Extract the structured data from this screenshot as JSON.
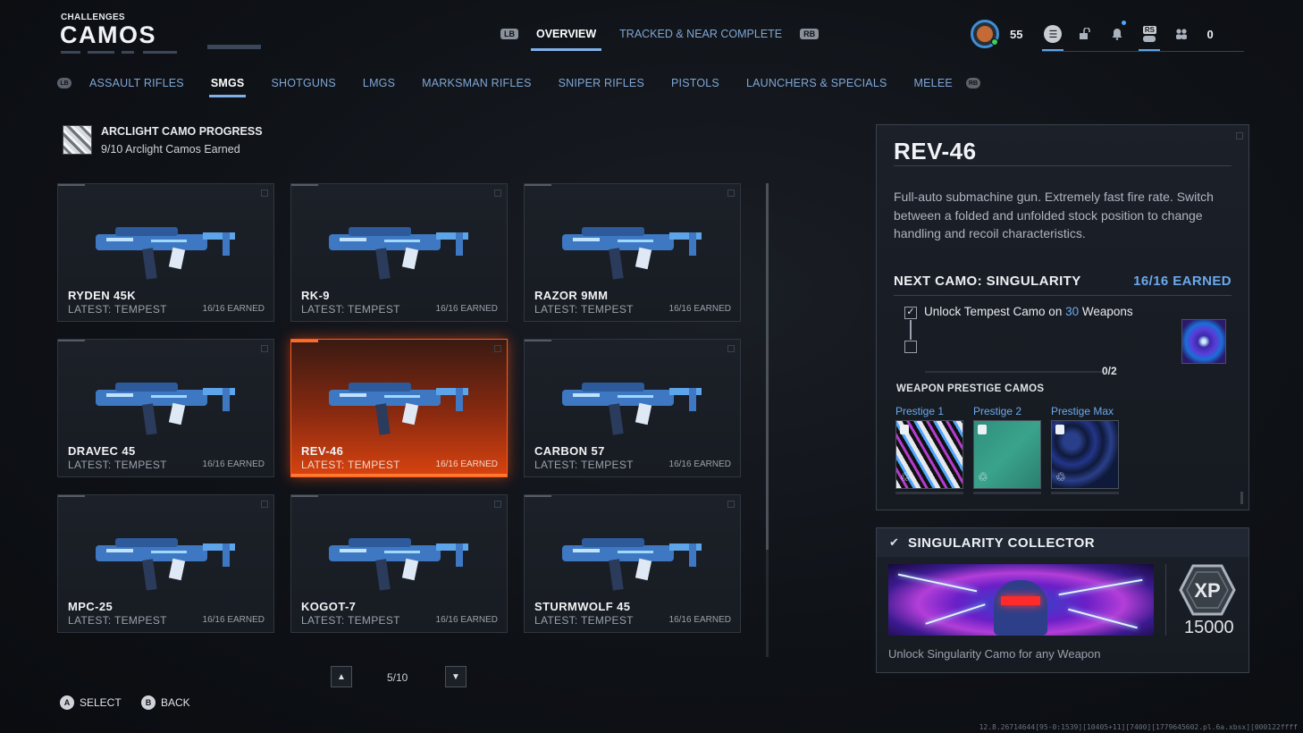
{
  "header": {
    "section": "CHALLENGES",
    "title": "CAMOS"
  },
  "top_nav": {
    "left_bumper": "LB",
    "right_bumper": "RB",
    "tabs": [
      {
        "label": "OVERVIEW",
        "active": true
      },
      {
        "label": "TRACKED & NEAR COMPLETE",
        "active": false
      }
    ]
  },
  "status_bar": {
    "player_level": "55",
    "stick_label": "RS",
    "currency": "0",
    "icons": [
      "player-level-icon",
      "menu-icon",
      "unlock-icon",
      "notification-icon",
      "controller-icon",
      "party-icon"
    ]
  },
  "category_bumper_left": "LB",
  "category_bumper_right": "RB",
  "categories": [
    {
      "label": "ASSAULT RIFLES",
      "active": false
    },
    {
      "label": "SMGS",
      "active": true
    },
    {
      "label": "SHOTGUNS",
      "active": false
    },
    {
      "label": "LMGS",
      "active": false
    },
    {
      "label": "MARKSMAN RIFLES",
      "active": false
    },
    {
      "label": "SNIPER RIFLES",
      "active": false
    },
    {
      "label": "PISTOLS",
      "active": false
    },
    {
      "label": "LAUNCHERS & SPECIALS",
      "active": false
    },
    {
      "label": "MELEE",
      "active": false
    }
  ],
  "arclight": {
    "title": "ARCLIGHT CAMO PROGRESS",
    "subtitle": "9/10 Arclight Camos Earned"
  },
  "weapons": [
    {
      "name": "RYDEN 45K",
      "latest": "LATEST: TEMPEST",
      "earned": "16/16 EARNED",
      "selected": false
    },
    {
      "name": "RK-9",
      "latest": "LATEST: TEMPEST",
      "earned": "16/16 EARNED",
      "selected": false
    },
    {
      "name": "RAZOR 9MM",
      "latest": "LATEST: TEMPEST",
      "earned": "16/16 EARNED",
      "selected": false
    },
    {
      "name": "DRAVEC 45",
      "latest": "LATEST: TEMPEST",
      "earned": "16/16 EARNED",
      "selected": false
    },
    {
      "name": "REV-46",
      "latest": "LATEST: TEMPEST",
      "earned": "16/16 EARNED",
      "selected": true
    },
    {
      "name": "CARBON 57",
      "latest": "LATEST: TEMPEST",
      "earned": "16/16 EARNED",
      "selected": false
    },
    {
      "name": "MPC-25",
      "latest": "LATEST: TEMPEST",
      "earned": "16/16 EARNED",
      "selected": false
    },
    {
      "name": "KOGOT-7",
      "latest": "LATEST: TEMPEST",
      "earned": "16/16 EARNED",
      "selected": false
    },
    {
      "name": "STURMWOLF 45",
      "latest": "LATEST: TEMPEST",
      "earned": "16/16 EARNED",
      "selected": false
    }
  ],
  "pager": {
    "text": "5/10"
  },
  "hints": {
    "select_glyph": "A",
    "select_label": "SELECT",
    "back_glyph": "B",
    "back_label": "BACK"
  },
  "details": {
    "weapon_name": "REV-46",
    "description": "Full-auto submachine gun. Extremely fast fire rate. Switch between a folded and unfolded stock position to change handling and recoil characteristics.",
    "next_camo_label": "NEXT CAMO: SINGULARITY",
    "next_camo_count": "16/16 EARNED",
    "requirement_prefix": "Unlock Tempest Camo on ",
    "requirement_count": "30",
    "requirement_suffix": " Weapons",
    "requirement_progress": "0/2",
    "requirement_progress_fraction": 0,
    "prestige_title": "WEAPON PRESTIGE CAMOS",
    "prestige": [
      {
        "label": "Prestige 1"
      },
      {
        "label": "Prestige 2"
      },
      {
        "label": "Prestige Max"
      }
    ]
  },
  "collector": {
    "title": "SINGULARITY COLLECTOR",
    "xp_label": "XP",
    "xp_value": "15000",
    "description": "Unlock Singularity Camo for any Weapon"
  },
  "build_info": "12.8.26714644[95-0:1539][10405+11][7400][1779645602.pl.6a.xbsx][000122ffff"
}
